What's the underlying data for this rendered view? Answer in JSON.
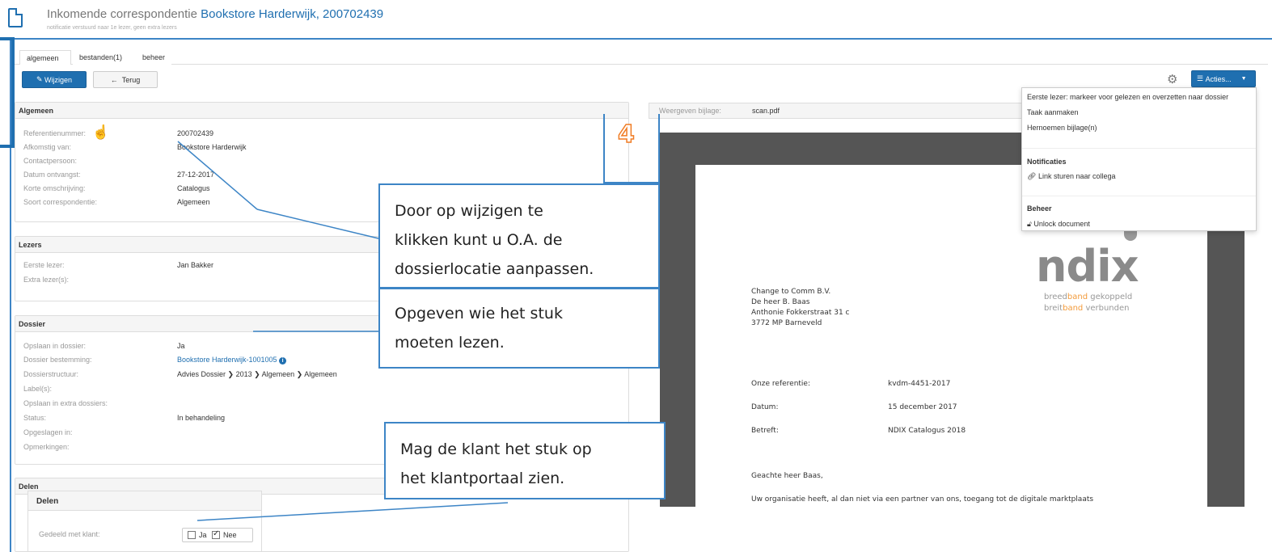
{
  "header": {
    "title_prefix": "Inkomende correspondentie",
    "title_subject": "Bookstore Harderwijk, 200702439",
    "subtitle": "notificatie verstuurd naar 1e lezer, geen extra lezers"
  },
  "tabs": [
    "algemeen",
    "bestanden(1)",
    "beheer"
  ],
  "toolbar": {
    "edit": "Wijzigen",
    "back": "Terug",
    "actions": "Acties..."
  },
  "algemeen": {
    "title": "Algemeen",
    "rows": [
      {
        "label": "Referentienummer:",
        "value": "200702439"
      },
      {
        "label": "Afkomstig van:",
        "value": "Bookstore Harderwijk"
      },
      {
        "label": "Contactpersoon:",
        "value": ""
      },
      {
        "label": "Datum ontvangst:",
        "value": "27-12-2017"
      },
      {
        "label": "Korte omschrijving:",
        "value": "Catalogus"
      },
      {
        "label": "Soort correspondentie:",
        "value": "Algemeen"
      }
    ]
  },
  "lezers": {
    "title": "Lezers",
    "rows": [
      {
        "label": "Eerste lezer:",
        "value": "Jan Bakker"
      },
      {
        "label": "Extra lezer(s):",
        "value": ""
      }
    ]
  },
  "dossier": {
    "title": "Dossier",
    "rows": [
      {
        "label": "Opslaan in dossier:",
        "value": "Ja"
      },
      {
        "label": "Dossier bestemming:",
        "value": "Bookstore Harderwijk-1001005"
      },
      {
        "label": "Dossierstructuur:",
        "value": "Advies Dossier  ❯ 2013  ❯ Algemeen  ❯ Algemeen"
      },
      {
        "label": "Label(s):",
        "value": ""
      },
      {
        "label": "Opslaan in extra dossiers:",
        "value": ""
      },
      {
        "label": "Status:",
        "value": "In behandeling"
      },
      {
        "label": "Opgeslagen in:",
        "value": ""
      },
      {
        "label": "Opmerkingen:",
        "value": ""
      }
    ]
  },
  "delen": {
    "title": "Delen",
    "inset_title": "Delen",
    "shared_label": "Gedeeld met klant:",
    "opt_yes": "Ja",
    "opt_no": "Nee",
    "yes_checked": false,
    "no_checked": true
  },
  "viewer": {
    "label": "Weergeven bijlage:",
    "file": "scan.pdf"
  },
  "document": {
    "addr1": "Change to Comm B.V.",
    "addr2": "De heer B. Baas",
    "addr3": "Anthonie Fokkerstraat 31 c",
    "addr4": "3772 MP Barneveld",
    "ref_label": "Onze referentie:",
    "ref_value": "kvdm-4451-2017",
    "date_label": "Datum:",
    "date_value": "15 december 2017",
    "subject_label": "Betreft:",
    "subject_value": "NDIX Catalogus 2018",
    "greeting": "Geachte heer Baas,",
    "body": "Uw organisatie heeft, al dan niet via een partner van ons, toegang tot de digitale marktplaats",
    "logo": "ndix",
    "tag1_a": "breed",
    "tag1_b": "band",
    "tag1_c": " gekoppeld",
    "tag2_a": "breit",
    "tag2_b": "band",
    "tag2_c": " verbunden"
  },
  "menu": {
    "items": [
      "Eerste lezer: markeer voor gelezen en overzetten naar dossier",
      "Taak aanmaken",
      "Hernoemen bijlage(n)"
    ],
    "notificaties_header": "Notificaties",
    "link_item": "Link sturen naar collega",
    "beheer_header": "Beheer",
    "unlock_item": "Unlock document"
  },
  "callouts": {
    "step": "4",
    "c1_line1": "Door op wijzigen te",
    "c1_line2": "klikken kunt u O.A. de",
    "c1_line3": "dossierlocatie aanpassen.",
    "c2_line1": "Opgeven wie het stuk",
    "c2_line2": "moeten lezen.",
    "c3_line1": "Mag de klant het stuk op",
    "c3_line2": "het klantportaal zien."
  },
  "colors": {
    "accent": "#1f6fb0",
    "annotation": "#3d85c6",
    "step_number": "#f07c24"
  },
  "icons": [
    "document-icon",
    "pencil-icon",
    "arrow-left-icon",
    "gear-icon",
    "list-icon",
    "caret-down-icon",
    "hand-cursor-icon",
    "info-icon",
    "link-icon",
    "unlock-icon",
    "checkbox-icon"
  ]
}
